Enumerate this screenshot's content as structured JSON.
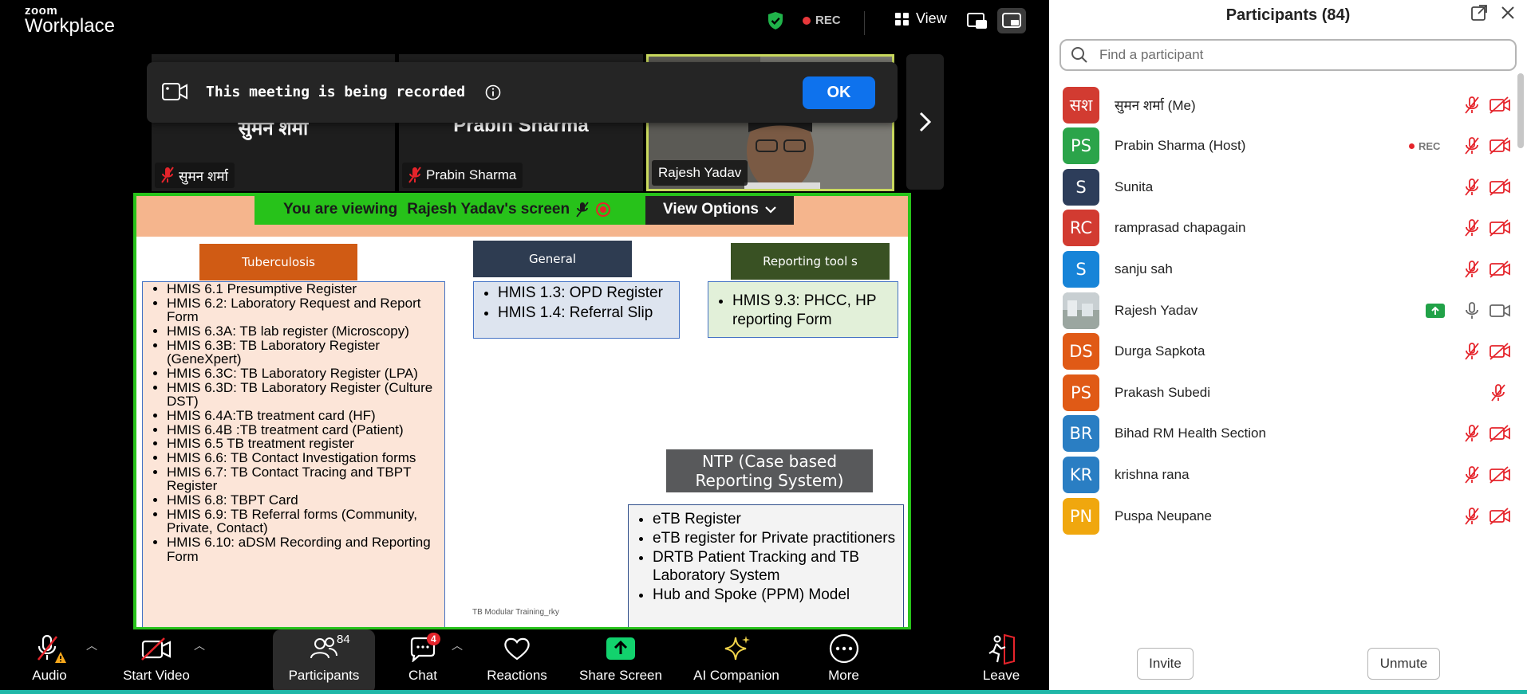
{
  "app": {
    "logo_top": "zoom",
    "logo_bottom": "Workplace"
  },
  "topbar": {
    "rec_label": "REC",
    "view_label": "View"
  },
  "video_tiles": [
    {
      "big_name": "सुमन शर्मा",
      "label": "सुमन शर्मा",
      "muted": true
    },
    {
      "big_name": "Prabin Sharma",
      "label": "Prabin Sharma",
      "muted": true
    },
    {
      "big_name": "",
      "label": "Rajesh Yadav",
      "muted": false
    }
  ],
  "recording_banner": {
    "text": "This meeting is being recorded",
    "ok_label": "OK"
  },
  "share": {
    "viewing_prefix": "You are viewing",
    "viewing_name": "Rajesh Yadav's screen",
    "view_options_label": "View Options"
  },
  "slide": {
    "tb_header": "Tuberculosis",
    "tb_items": [
      "HMIS 6.1 Presumptive Register",
      "HMIS 6.2: Laboratory Request and Report Form",
      "HMIS 6.3A: TB lab register (Microscopy)",
      "HMIS 6.3B: TB Laboratory Register (GeneXpert)",
      "HMIS 6.3C: TB Laboratory Register (LPA)",
      "HMIS 6.3D: TB Laboratory Register (Culture DST)",
      "HMIS 6.4A:TB treatment card (HF)",
      "HMIS 6.4B :TB treatment card (Patient)",
      "HMIS 6.5 TB treatment register",
      "HMIS 6.6: TB Contact Investigation forms",
      "HMIS 6.7: TB Contact Tracing and TBPT Register",
      "HMIS 6.8: TBPT Card",
      "HMIS 6.9:  TB Referral forms (Community, Private, Contact)",
      "HMIS 6.10: aDSM Recording and Reporting Form"
    ],
    "gen_header": "General",
    "gen_items": [
      "HMIS 1.3: OPD Register",
      "HMIS 1.4: Referral Slip"
    ],
    "rep_header": "Reporting tool s",
    "rep_items": [
      "HMIS 9.3: PHCC, HP reporting Form"
    ],
    "ntp_header": "NTP (Case based Reporting System)",
    "ntp_items": [
      "eTB Register",
      "eTB register for Private practitioners",
      "DRTB Patient Tracking and TB Laboratory System",
      "Hub and Spoke (PPM) Model"
    ],
    "footer": "TB Modular Training_rky"
  },
  "toolbar": {
    "audio": "Audio",
    "start_video": "Start Video",
    "participants": "Participants",
    "participants_count": "84",
    "chat": "Chat",
    "chat_badge": "4",
    "reactions": "Reactions",
    "share_screen": "Share Screen",
    "ai_companion": "AI Companion",
    "more": "More",
    "leave": "Leave"
  },
  "panel": {
    "title": "Participants (84)",
    "search_placeholder": "Find a participant",
    "invite_label": "Invite",
    "unmute_label": "Unmute",
    "participants": [
      {
        "initials": "सश",
        "color": "#d23b31",
        "name": "सुमन शर्मा (Me)",
        "mic": "muted",
        "cam": "off"
      },
      {
        "initials": "PS",
        "color": "#2ba44a",
        "name": "Prabin Sharma (Host)",
        "rec": "REC",
        "mic": "muted",
        "cam": "off"
      },
      {
        "initials": "S",
        "color": "#2d3d5a",
        "name": "Sunita",
        "mic": "muted",
        "cam": "off"
      },
      {
        "initials": "RC",
        "color": "#d23b31",
        "name": "ramprasad chapagain",
        "mic": "muted",
        "cam": "off"
      },
      {
        "initials": "S",
        "color": "#1784d8",
        "name": "sanju sah",
        "mic": "muted",
        "cam": "off"
      },
      {
        "initials": "",
        "color": "#9aa5a8",
        "name": "Rajesh Yadav",
        "sharing": true,
        "mic": "on",
        "cam": "on"
      },
      {
        "initials": "DS",
        "color": "#e05a16",
        "name": "Durga Sapkota",
        "mic": "muted",
        "cam": "off"
      },
      {
        "initials": "PS",
        "color": "#e05a16",
        "name": "Prakash Subedi",
        "mic": "muted",
        "cam": "none"
      },
      {
        "initials": "BR",
        "color": "#2a7ec3",
        "name": "Bihad RM Health Section",
        "mic": "muted",
        "cam": "off"
      },
      {
        "initials": "KR",
        "color": "#2a7ec3",
        "name": "krishna rana",
        "mic": "muted",
        "cam": "off"
      },
      {
        "initials": "PN",
        "color": "#f0a70e",
        "name": "Puspa Neupane",
        "mic": "muted",
        "cam": "off"
      }
    ]
  },
  "colors": {
    "accent_blue": "#0e72ed",
    "share_border": "#27c21a",
    "muted_red": "#e5242b"
  }
}
